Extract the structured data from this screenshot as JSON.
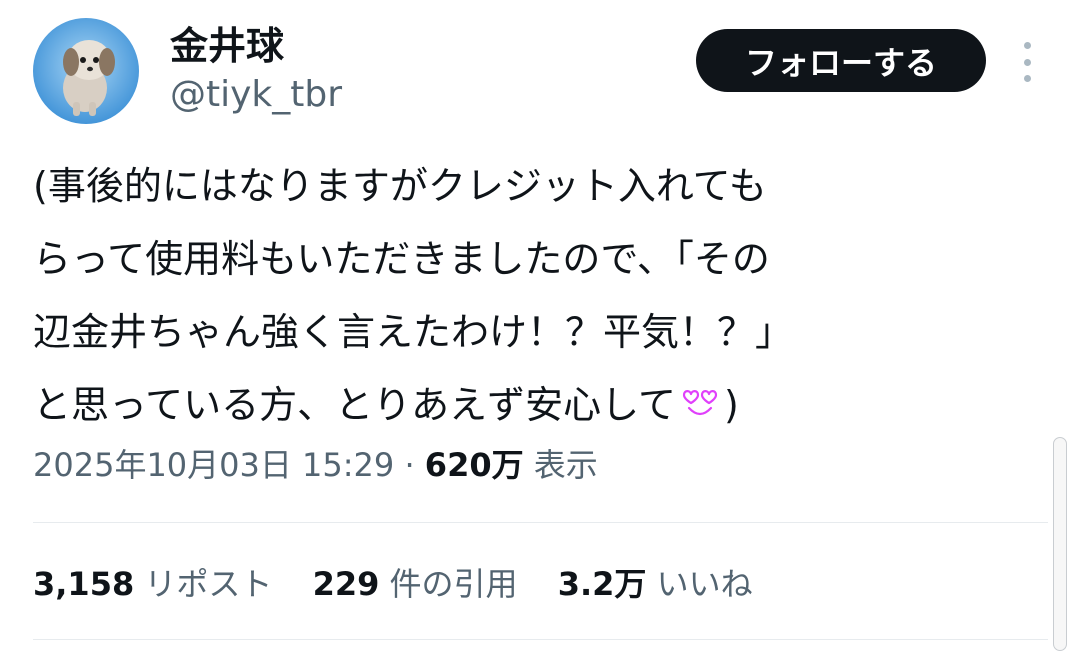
{
  "user": {
    "display_name": "金井球",
    "handle": "@tiyk_tbr"
  },
  "follow_button": "フォローする",
  "tweet": {
    "lines": [
      "(事後的にはなりますがクレジット入れても",
      "らって使用料もいただきましたので、「その",
      "辺金井ちゃん強く言えたわけ！？平気！？」",
      "と思っている方、とりあえず安心して",
      ")"
    ],
    "emoji_icon": "smiling-face-with-heart-eyes-icon"
  },
  "meta": {
    "timestamp": "2025年10月03日 15:29",
    "separator": "·",
    "views": "620万",
    "views_label": "表示"
  },
  "stats": {
    "reposts": "3,158",
    "reposts_label": "リポスト",
    "quotes": "229",
    "quotes_label": "件の引用",
    "likes": "3.2万",
    "likes_label": "いいね"
  },
  "colors": {
    "text_primary": "#0f1419",
    "text_secondary": "#536471",
    "follow_button_bg": "#0f1419",
    "divider": "#e7ebee",
    "emoji_outline": "#e040fb"
  }
}
